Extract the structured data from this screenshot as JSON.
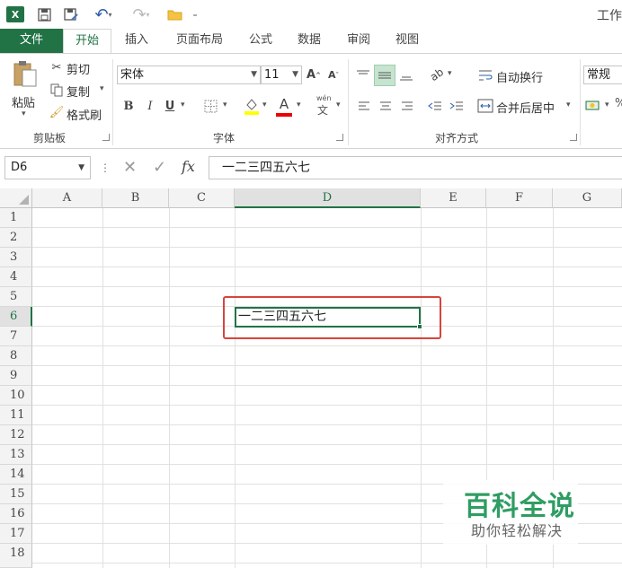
{
  "title_bar": {
    "app_icon": "X",
    "title": "工作"
  },
  "ribbon_tabs": [
    "文件",
    "开始",
    "插入",
    "页面布局",
    "公式",
    "数据",
    "审阅",
    "视图"
  ],
  "clipboard": {
    "paste": "粘贴",
    "cut": "剪切",
    "copy": "复制",
    "format_painter": "格式刷",
    "group": "剪贴板"
  },
  "font": {
    "name": "宋体",
    "size": "11",
    "bold": "B",
    "italic": "I",
    "underline": "U",
    "font_color": "A",
    "pinyin_top": "wén",
    "pinyin_bottom": "文",
    "group": "字体"
  },
  "alignment": {
    "wrap_text": "自动换行",
    "merge_center": "合并后居中",
    "group": "对齐方式"
  },
  "number": {
    "format": "常规"
  },
  "formula_bar": {
    "name_box": "D6",
    "fx": "fx",
    "content": "一二三四五六七"
  },
  "columns": [
    "A",
    "B",
    "C",
    "D",
    "E",
    "F",
    "G"
  ],
  "rows": [
    "1",
    "2",
    "3",
    "4",
    "5",
    "6",
    "7",
    "8",
    "9",
    "10",
    "11",
    "12",
    "13",
    "14",
    "15",
    "16",
    "17",
    "18"
  ],
  "active_cell": {
    "ref": "D6",
    "value": "一二三四五六七"
  },
  "watermark": {
    "title": "百科全说",
    "subtitle": "助你轻松解决"
  },
  "colors": {
    "excel_green": "#217346",
    "highlight_red": "#d6453d",
    "watermark_green": "#2f9d63"
  }
}
